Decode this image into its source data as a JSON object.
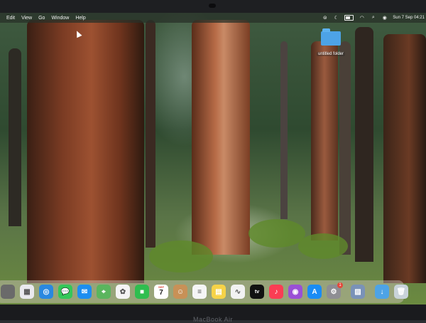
{
  "menubar": {
    "items": [
      "Edit",
      "View",
      "Go",
      "Window",
      "Help"
    ],
    "status_icons": [
      "control-center-icon",
      "focus-moon-icon",
      "battery-icon",
      "wifi-icon",
      "search-icon",
      "siri-icon"
    ],
    "clock": "Sun 7 Sep  04:21"
  },
  "desktop": {
    "folder_label": "untitled folder"
  },
  "dock": {
    "icons": [
      {
        "name": "partial-app-icon",
        "glyph": "",
        "color": "#6a6a6a"
      },
      {
        "name": "launchpad-icon",
        "glyph": "▦",
        "color": "#e9e9ee"
      },
      {
        "name": "safari-icon",
        "glyph": "◎",
        "color": "#2a88e0"
      },
      {
        "name": "messages-icon",
        "glyph": "💬",
        "color": "#34c759"
      },
      {
        "name": "mail-icon",
        "glyph": "✉",
        "color": "#1d8ef0"
      },
      {
        "name": "maps-icon",
        "glyph": "⌖",
        "color": "#5ab55e"
      },
      {
        "name": "photos-icon",
        "glyph": "✿",
        "color": "#f4f4f4"
      },
      {
        "name": "facetime-icon",
        "glyph": "■",
        "color": "#2fbe4f"
      },
      {
        "name": "calendar-icon",
        "glyph": "",
        "color": "#ffffff"
      },
      {
        "name": "contacts-icon",
        "glyph": "☺",
        "color": "#c89157"
      },
      {
        "name": "reminders-icon",
        "glyph": "≡",
        "color": "#f5f5f5"
      },
      {
        "name": "notes-icon",
        "glyph": "▤",
        "color": "#f6d348"
      },
      {
        "name": "freeform-icon",
        "glyph": "∿",
        "color": "#f2f2f2"
      },
      {
        "name": "apple-tv-icon",
        "glyph": "tv",
        "color": "#111111"
      },
      {
        "name": "music-icon",
        "glyph": "♪",
        "color": "#fa3d54"
      },
      {
        "name": "podcasts-icon",
        "glyph": "◉",
        "color": "#9a4fd6"
      },
      {
        "name": "app-store-icon",
        "glyph": "A",
        "color": "#1a8cf5"
      },
      {
        "name": "system-settings-icon",
        "glyph": "⚙",
        "color": "#8e8e93",
        "badge": "1"
      },
      {
        "separator": true
      },
      {
        "name": "preview-icon",
        "glyph": "▨",
        "color": "#7a92b8"
      },
      {
        "separator": true
      },
      {
        "name": "downloads-folder-icon",
        "glyph": "↓",
        "color": "#4da3e6"
      },
      {
        "name": "trash-icon",
        "glyph": "🗑",
        "color": "#c9d3da"
      }
    ],
    "calendar_month": "SEP",
    "calendar_day": "7"
  },
  "bezel": {
    "label": "MacBook Air"
  }
}
